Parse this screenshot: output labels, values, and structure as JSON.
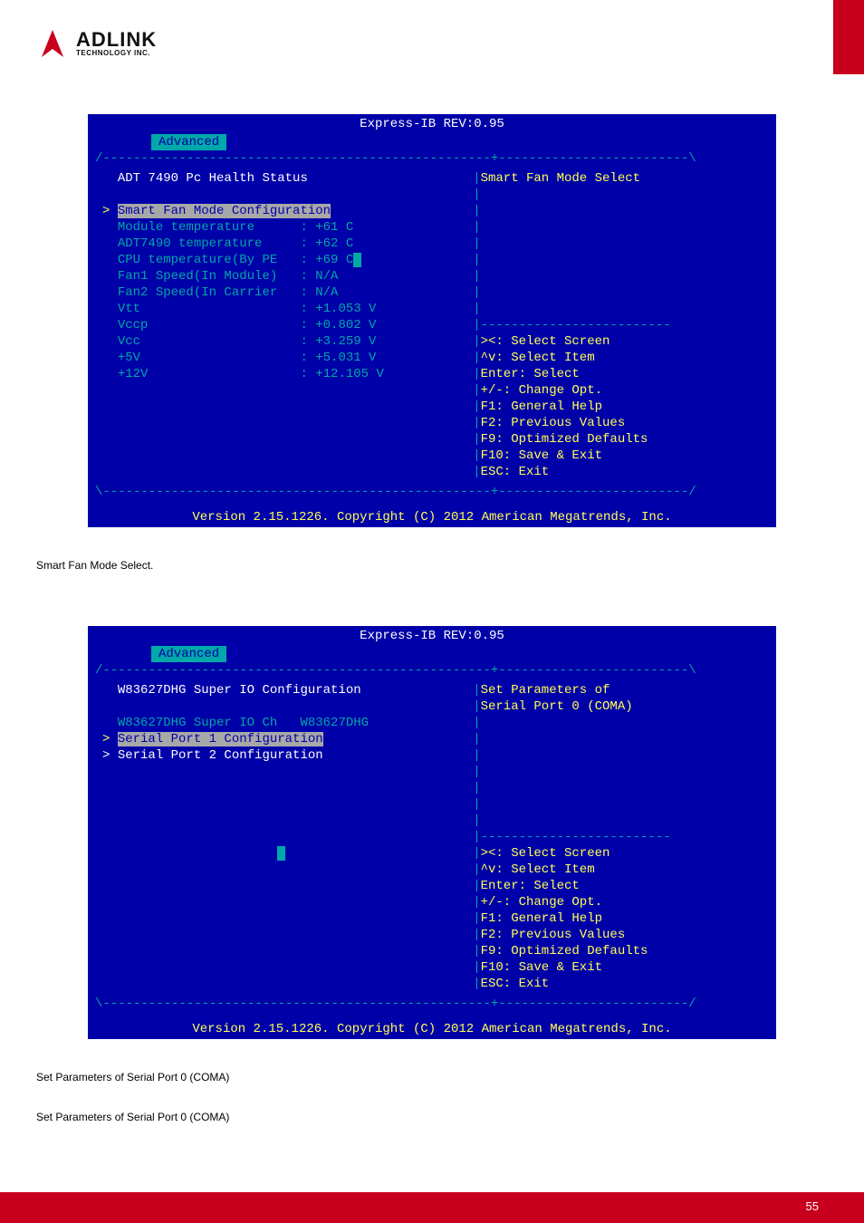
{
  "logo": {
    "big": "ADLINK",
    "small": "TECHNOLOGY INC."
  },
  "bios1": {
    "title": "Express-IB REV:0.95",
    "tab": "Advanced",
    "heading": "ADT 7490 Pc Health Status",
    "help_top": "Smart Fan Mode Select",
    "rows": [
      {
        "l": "Smart Fan Mode Configuration",
        "sel": true
      },
      {
        "l": "Module temperature      : +61 C"
      },
      {
        "l": "ADT7490 temperature     : +62 C"
      },
      {
        "l": "CPU temperature(By PE   : +69 C",
        "hot": true
      },
      {
        "l": "Fan1 Speed(In Module)   : N/A"
      },
      {
        "l": "Fan2 Speed(In Carrier   : N/A"
      },
      {
        "l": "Vtt                     : +1.053 V"
      },
      {
        "l": "Vccp                    : +0.802 V"
      },
      {
        "l": "Vcc                     : +3.259 V"
      },
      {
        "l": "+5V                     : +5.031 V"
      },
      {
        "l": "+12V                    : +12.105 V"
      }
    ],
    "help": [
      "><: Select Screen",
      "^v: Select Item",
      "Enter: Select",
      "+/-: Change Opt.",
      "F1: General Help",
      "F2: Previous Values",
      "F9: Optimized Defaults",
      "F10: Save & Exit",
      "ESC: Exit"
    ],
    "copyright": "Version 2.15.1226. Copyright (C) 2012 American Megatrends, Inc."
  },
  "caption1": "Smart Fan Mode Select.",
  "bios2": {
    "title": "Express-IB REV:0.95",
    "tab": "Advanced",
    "heading": "W83627DHG Super IO Configuration",
    "help_top1": "Set Parameters of",
    "help_top2": "Serial Port 0 (COMA)",
    "rows": [
      {
        "l": "W83627DHG Super IO Ch   W83627DHG"
      },
      {
        "l": "Serial Port 1 Configuration",
        "sel": true
      },
      {
        "l": "Serial Port 2 Configuration",
        "white": true
      }
    ],
    "help": [
      "><: Select Screen",
      "^v: Select Item",
      "Enter: Select",
      "+/-: Change Opt.",
      "F1: General Help",
      "F2: Previous Values",
      "F9: Optimized Defaults",
      "F10: Save & Exit",
      "ESC: Exit"
    ],
    "copyright": "Version 2.15.1226. Copyright (C) 2012 American Megatrends, Inc."
  },
  "caption2": "Set Parameters of Serial Port 0 (COMA)",
  "caption3": "Set Parameters of Serial Port 0 (COMA)",
  "pageNumber": "55"
}
